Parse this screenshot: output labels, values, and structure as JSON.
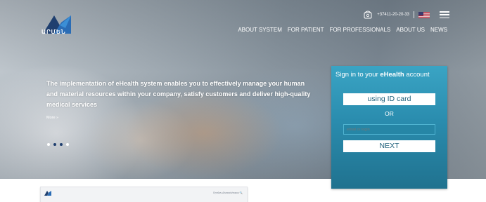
{
  "header": {
    "logo_text": "ԱՐՄԵՆ",
    "phone": "+37411-20-20-33",
    "flag_icon": "us-flag-icon",
    "menu_icon": "hamburger-menu-icon"
  },
  "nav": {
    "items": [
      "ABOUT SYSTEM",
      "FOR PATIENT",
      "FOR PROFESSIONALS",
      "ABOUT US",
      "NEWS"
    ]
  },
  "hero": {
    "text": "The implementation of eHealth system enables you to effectively manage your human and material resources within your company, satisfy customers and deliver high-quality medical services",
    "more_link": "More »",
    "slides": 4,
    "active_slide": 2
  },
  "login": {
    "title_prefix": "Sign in to your ",
    "title_brand": "eHealth",
    "title_suffix": " account",
    "id_card_button": "using ID card",
    "or_text": "OR",
    "email_placeholder": "email or login",
    "next_button": "NEXT"
  },
  "preview": {
    "search_placeholder": "Որոնում/search/поиск"
  },
  "colors": {
    "brand_blue": "#1f3f6f",
    "login_panel": "#2a8cae"
  }
}
